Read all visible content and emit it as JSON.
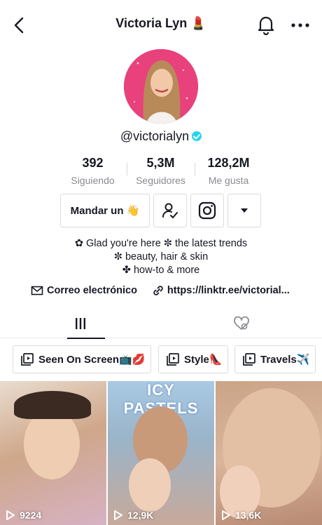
{
  "header": {
    "title": "Victoria Lyn 💄"
  },
  "profile": {
    "handle": "@victorialyn",
    "stats": [
      {
        "value": "392",
        "label": "Siguiendo"
      },
      {
        "value": "5,3M",
        "label": "Seguidores"
      },
      {
        "value": "128,2M",
        "label": "Me gusta"
      }
    ],
    "message_button": "Mandar un 👋",
    "bio": [
      "✿ Glad you're here ✼ the latest trends",
      "✼ beauty, hair & skin",
      "✤ how-to & more"
    ],
    "email_label": "Correo electrónico",
    "link_label": "https://linktr.ee/victorial..."
  },
  "playlists": [
    {
      "label": "Seen On Screen📺💋"
    },
    {
      "label": "Style👠"
    },
    {
      "label": "Travels✈️"
    }
  ],
  "videos": [
    {
      "views": "9224"
    },
    {
      "views": "12,9K",
      "banner": "ICY PASTELS"
    },
    {
      "views": "13,6K"
    }
  ],
  "colors": {
    "accent_verified": "#20d5ec",
    "avatar_bg": "#e8417c",
    "text": "#161823",
    "muted": "#8a8b91"
  }
}
